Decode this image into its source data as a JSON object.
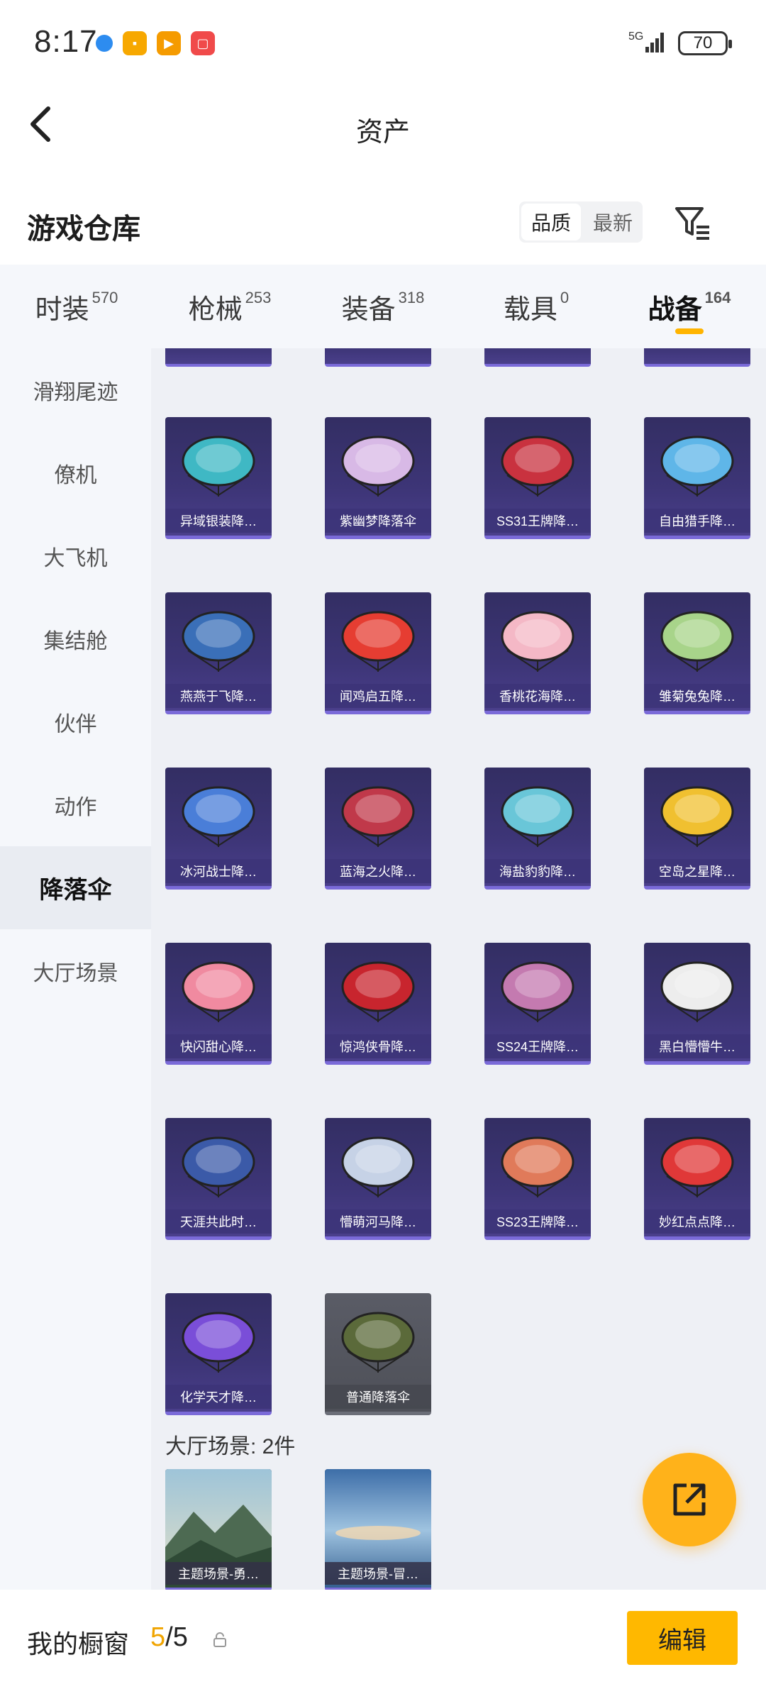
{
  "status_bar": {
    "time": "8:17",
    "network": "5G",
    "battery": "70"
  },
  "nav": {
    "title": "资产"
  },
  "warehouse": {
    "title": "游戏仓库",
    "sort_options": [
      "品质",
      "最新"
    ],
    "sort_active": "品质"
  },
  "tabs": [
    {
      "label": "时装",
      "count": "570"
    },
    {
      "label": "枪械",
      "count": "253"
    },
    {
      "label": "装备",
      "count": "318"
    },
    {
      "label": "载具",
      "count": "0"
    },
    {
      "label": "战备",
      "count": "164",
      "active": true
    }
  ],
  "sidebar": {
    "items": [
      "滑翔尾迹",
      "僚机",
      "大飞机",
      "集结舱",
      "伙伴",
      "动作",
      "降落伞",
      "大厅场景"
    ],
    "active": "降落伞"
  },
  "parachutes": [
    {
      "name": "异域银装降…",
      "color": "#3fb8c4"
    },
    {
      "name": "紫幽梦降落伞",
      "color": "#d8b9e6"
    },
    {
      "name": "SS31王牌降…",
      "color": "#c9323f"
    },
    {
      "name": "自由猎手降…",
      "color": "#5fb6e8"
    },
    {
      "name": "燕燕于飞降…",
      "color": "#3a6fb8"
    },
    {
      "name": "闻鸡启五降…",
      "color": "#e63d32"
    },
    {
      "name": "香桃花海降…",
      "color": "#f4b8c6"
    },
    {
      "name": "雏菊兔兔降…",
      "color": "#a8d48a"
    },
    {
      "name": "冰河战士降…",
      "color": "#4a7ed8"
    },
    {
      "name": "蓝海之火降…",
      "color": "#c0394a"
    },
    {
      "name": "海盐豹豹降…",
      "color": "#69c6d8"
    },
    {
      "name": "空岛之星降…",
      "color": "#f0c030"
    },
    {
      "name": "快闪甜心降…",
      "color": "#f08aa0"
    },
    {
      "name": "惊鸿侠骨降…",
      "color": "#c8252e"
    },
    {
      "name": "SS24王牌降…",
      "color": "#c47ab0"
    },
    {
      "name": "黑白懵懵牛…",
      "color": "#ededed"
    },
    {
      "name": "天涯共此时…",
      "color": "#3b5aa8"
    },
    {
      "name": "懵萌河马降…",
      "color": "#c6d2e6"
    },
    {
      "name": "SS23王牌降…",
      "color": "#e07a5a"
    },
    {
      "name": "妙红点点降…",
      "color": "#e03838"
    },
    {
      "name": "化学天才降…",
      "color": "#7a4ed8"
    },
    {
      "name": "普通降落伞",
      "color": "#5b6a3a",
      "gray": true
    }
  ],
  "lobby_scene": {
    "label": "大厅场景: 2件",
    "items": [
      {
        "name": "主题场景-勇…"
      },
      {
        "name": "主题场景-冒…"
      }
    ]
  },
  "bottom": {
    "label": "我的橱窗",
    "current": "5",
    "total": "5",
    "separator": "/",
    "edit": "编辑"
  },
  "colors": {
    "accent": "#ffb800",
    "card_bg": "#3d3577"
  }
}
